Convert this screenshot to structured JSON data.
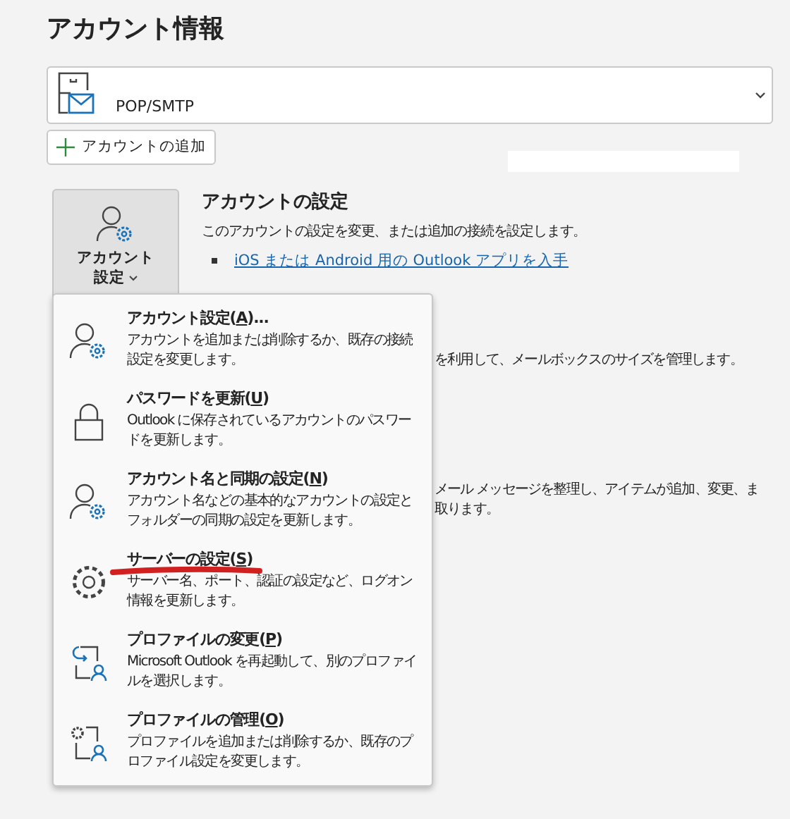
{
  "title": "アカウント情報",
  "account_selector": {
    "type": "POP/SMTP"
  },
  "add_account_button": {
    "label": "アカウントの追加"
  },
  "account_settings": {
    "button_label_1": "アカウント",
    "button_label_2": "設定",
    "heading": "アカウントの設定",
    "description": "このアカウントの設定を変更、または追加の接続を設定します。",
    "link": "iOS または Android 用の Outlook アプリを入手"
  },
  "background_texts": [
    "を利用して、メールボックスのサイズを管理します。",
    "メール メッセージを整理し、アイテムが追加、変更、ま",
    "取ります。"
  ],
  "menu": {
    "items": [
      {
        "kind": "account",
        "title": "アカウント設定(",
        "key": "A",
        "title_end": ")...",
        "description": "アカウントを追加または削除するか、既存の接続設定を変更します。",
        "highlighted": false
      },
      {
        "kind": "lock",
        "title": "パスワードを更新(",
        "key": "U",
        "title_end": ")",
        "description": "Outlook に保存されているアカウントのパスワードを更新します。",
        "highlighted": false
      },
      {
        "kind": "account",
        "title": "アカウント名と同期の設定(",
        "key": "N",
        "title_end": ")",
        "description": "アカウント名などの基本的なアカウントの設定とフォルダーの同期の設定を更新します。",
        "highlighted": false
      },
      {
        "kind": "gear",
        "title": "サーバーの設定(",
        "key": "S",
        "title_end": ")",
        "description": "サーバー名、ポート、認証の設定など、ログオン情報を更新します。",
        "highlighted": true
      },
      {
        "kind": "profile_change",
        "title": "プロファイルの変更(",
        "key": "P",
        "title_end": ")",
        "description": "Microsoft Outlook を再起動して、別のプロファイルを選択します。",
        "highlighted": false
      },
      {
        "kind": "profile_manage",
        "title": "プロファイルの管理(",
        "key": "O",
        "title_end": ")",
        "description": "プロファイルを追加または削除するか、既存のプロファイル設定を変更します。",
        "highlighted": false
      }
    ]
  }
}
